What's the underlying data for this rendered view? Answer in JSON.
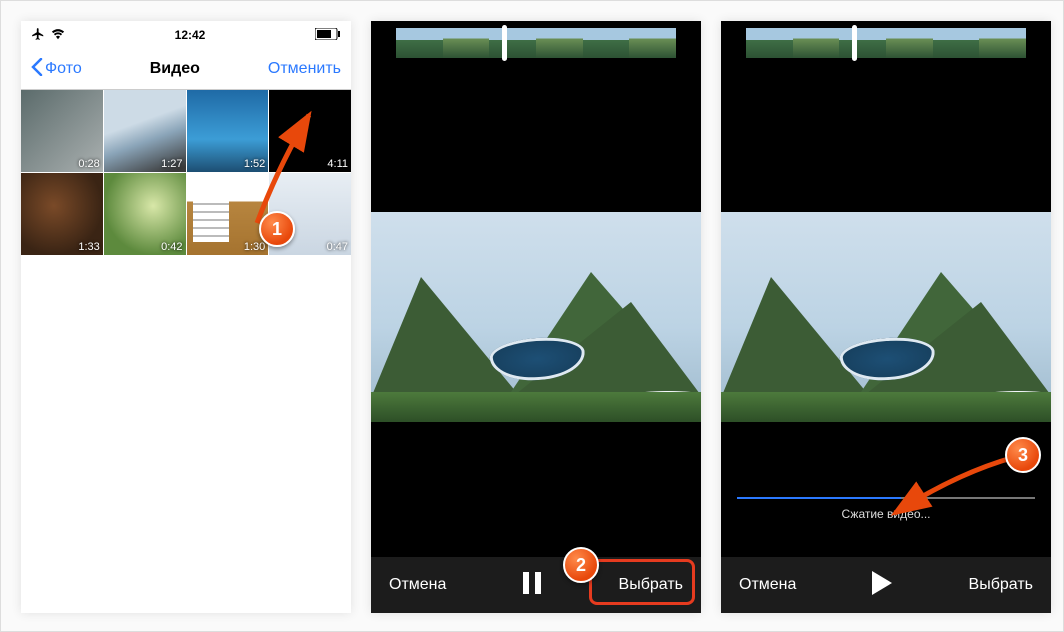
{
  "status": {
    "time": "12:42"
  },
  "gallery": {
    "back_label": "Фото",
    "title": "Видео",
    "cancel_label": "Отменить",
    "thumbs": [
      {
        "duration": "0:28"
      },
      {
        "duration": "1:27"
      },
      {
        "duration": "1:52"
      },
      {
        "duration": "4:11"
      },
      {
        "duration": "1:33"
      },
      {
        "duration": "0:42"
      },
      {
        "duration": "1:30"
      },
      {
        "duration": "0:47"
      }
    ]
  },
  "player": {
    "cancel_label": "Отмена",
    "choose_label": "Выбрать",
    "compress_label": "Сжатие видео..."
  },
  "annotations": {
    "b1": "1",
    "b2": "2",
    "b3": "3"
  }
}
